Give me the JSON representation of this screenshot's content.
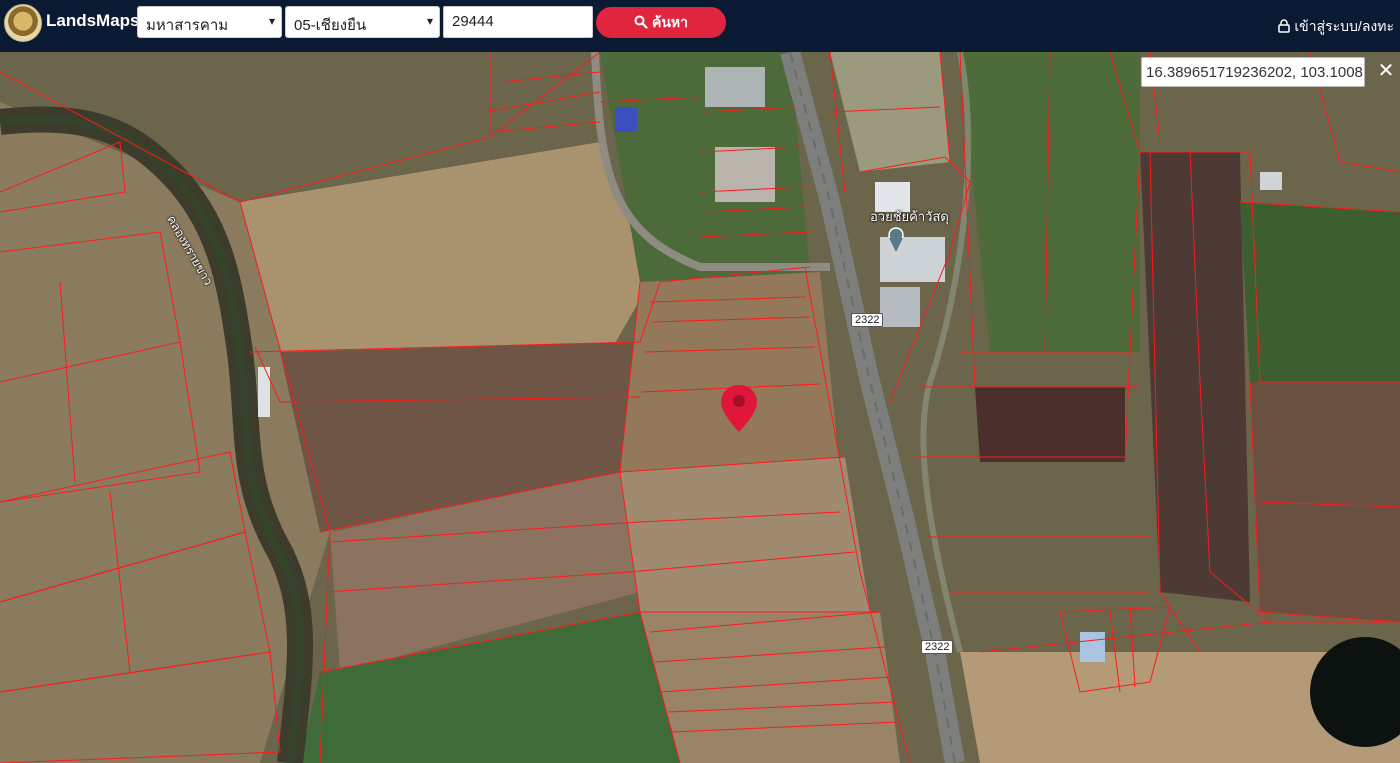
{
  "header": {
    "brand": "LandsMaps",
    "province_select": "มหาสารคาม",
    "district_select": "05-เชียงยืน",
    "parcel_input_value": "29444",
    "search_label": "ค้นหา",
    "login_label": "เข้าสู่ระบบ/ลงทะ"
  },
  "map": {
    "coordinates": "16.389651719236202, 103.1008",
    "close_label": "✕",
    "place_label": "อวยชัยค้าวัสดุ",
    "canal_label": "คลองทรายขาว",
    "road_number_1": "2322",
    "road_number_2": "2322"
  },
  "icons": {
    "logo": "seal-logo-icon",
    "search": "search-icon",
    "lock": "lock-icon",
    "pin": "map-pin-icon",
    "place": "place-marker-icon"
  },
  "colors": {
    "topbar": "#0b1a33",
    "search_button": "#e0263f",
    "parcel_lines": "#ff1a1a",
    "pin": "#e0173a"
  }
}
